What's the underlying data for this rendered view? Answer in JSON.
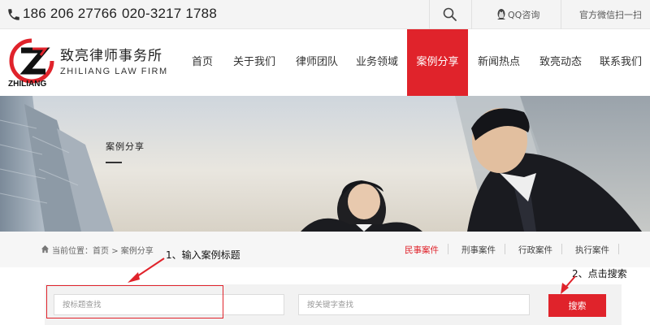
{
  "topbar": {
    "phone1": "186 206 27766",
    "phone2": "020-3217 1788",
    "qq_label": "QQ咨询",
    "wechat_label": "官方微信扫一扫",
    "icons": [
      "phone-icon",
      "search-icon",
      "qq-penguin-icon"
    ]
  },
  "logo": {
    "name_cn": "致亮律师事务所",
    "name_en": "ZHILIANG LAW FIRM",
    "mark_text": "ZHILIANG"
  },
  "nav": {
    "items": [
      {
        "label": "首页"
      },
      {
        "label": "关于我们"
      },
      {
        "label": "律师团队"
      },
      {
        "label": "业务领域"
      },
      {
        "label": "案例分享",
        "active": true
      },
      {
        "label": "新闻热点"
      },
      {
        "label": "致亮动态"
      },
      {
        "label": "联系我们"
      }
    ]
  },
  "banner": {
    "title": "案例分享"
  },
  "breadcrumb": {
    "prefix": "当前位置：",
    "home": "首页",
    "separator": ">",
    "current": "案例分享"
  },
  "categories": [
    {
      "label": "民事案件",
      "active": true
    },
    {
      "label": "刑事案件"
    },
    {
      "label": "行政案件"
    },
    {
      "label": "执行案件"
    }
  ],
  "search": {
    "title_placeholder": "按标题查找",
    "keyword_placeholder": "按关键字查找",
    "button_label": "搜索"
  },
  "annotations": {
    "step1": "1、输入案例标题",
    "step2": "2、点击搜索"
  },
  "colors": {
    "accent": "#e0232b",
    "topbar_bg": "#f4f4f4",
    "crumb_bg": "#f6f6f6"
  }
}
